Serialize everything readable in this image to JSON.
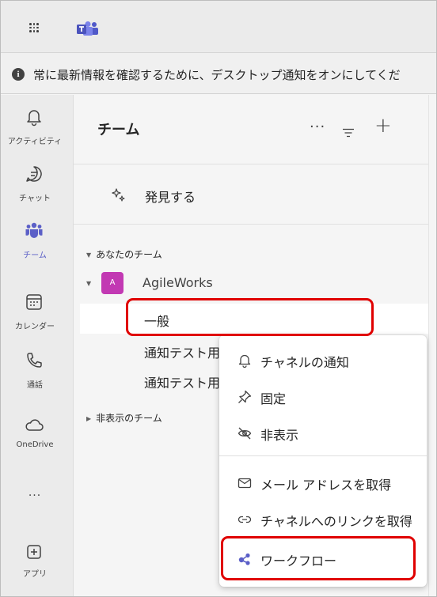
{
  "banner": {
    "text": "常に最新情報を確認するために、デスクトップ通知をオンにしてくだ"
  },
  "rail": {
    "items": [
      {
        "label": "アクティビティ",
        "icon": "bell-icon"
      },
      {
        "label": "チャット",
        "icon": "chat-icon"
      },
      {
        "label": "チーム",
        "icon": "teams-icon",
        "active": true
      },
      {
        "label": "カレンダー",
        "icon": "calendar-icon"
      },
      {
        "label": "通話",
        "icon": "phone-icon"
      },
      {
        "label": "OneDrive",
        "icon": "cloud-icon"
      },
      {
        "label": "...",
        "icon": "more-icon"
      },
      {
        "label": "アプリ",
        "icon": "apps-icon"
      }
    ]
  },
  "panel": {
    "title": "チーム",
    "more": "···",
    "discover_label": "発見する",
    "your_teams_label": "あなたのチーム",
    "team": {
      "avatar": "A",
      "name": "AgileWorks"
    },
    "channels": [
      "一般",
      "通知テスト用",
      "通知テスト用"
    ],
    "hidden_teams_label": "非表示のチーム"
  },
  "context_menu": {
    "items": [
      {
        "label": "チャネルの通知",
        "icon": "bell-icon"
      },
      {
        "label": "固定",
        "icon": "pin-icon"
      },
      {
        "label": "非表示",
        "icon": "eye-off-icon"
      },
      {
        "label": "メール アドレスを取得",
        "icon": "mail-icon"
      },
      {
        "label": "チャネルへのリンクを取得",
        "icon": "link-icon"
      },
      {
        "label": "ワークフロー",
        "icon": "workflow-icon"
      }
    ]
  },
  "colors": {
    "accent": "#5b5fc7",
    "team_avatar": "#c239b3",
    "highlight": "#e00000"
  }
}
